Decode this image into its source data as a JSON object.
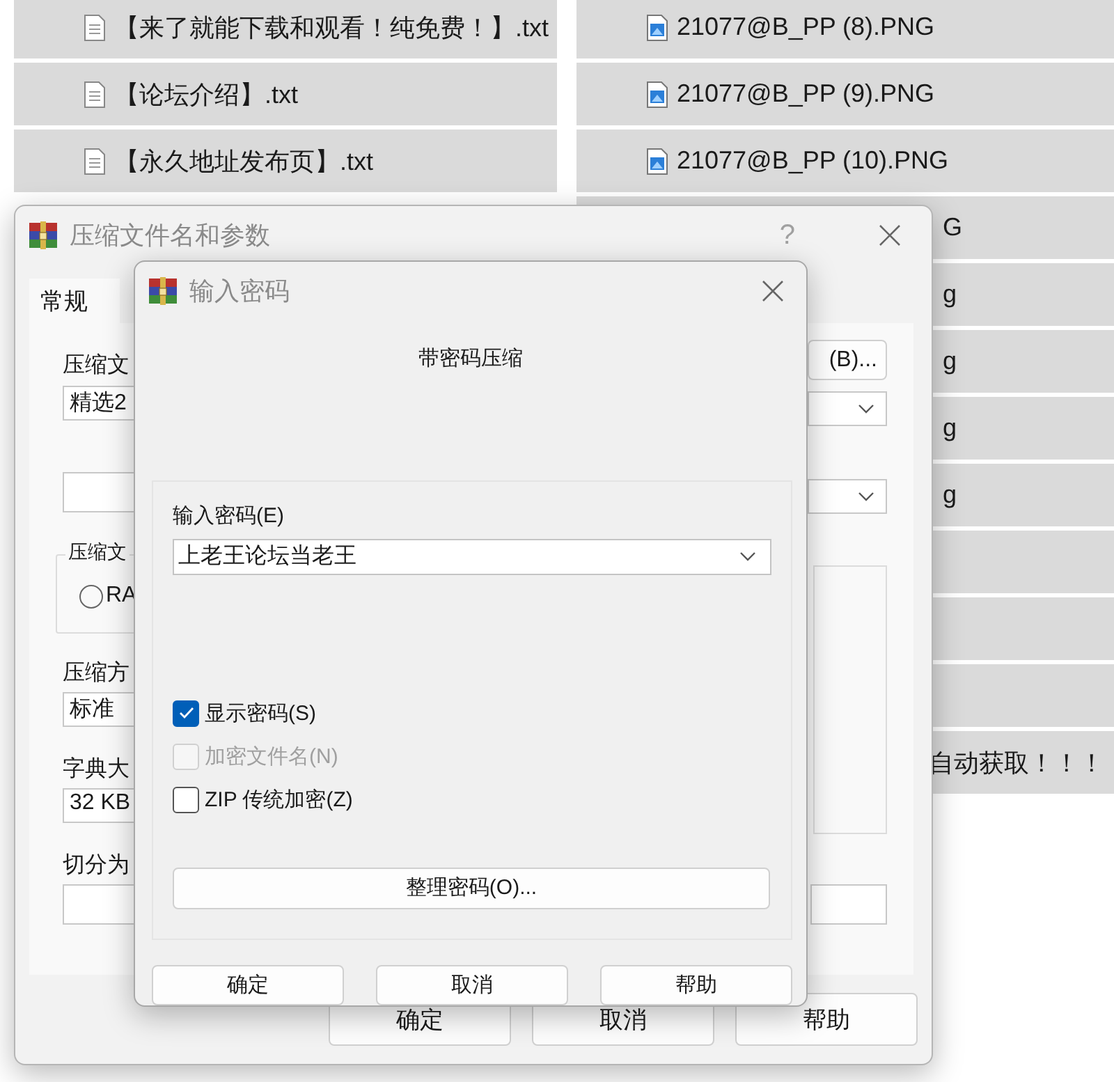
{
  "files_left": [
    {
      "name": "【来了就能下载和观看！纯免费！】.txt",
      "kind": "text"
    },
    {
      "name": "【论坛介绍】.txt",
      "kind": "text"
    },
    {
      "name": "【永久地址发布页】.txt",
      "kind": "text"
    }
  ],
  "files_right": [
    {
      "name": "21077@B_PP (8).PNG",
      "kind": "image"
    },
    {
      "name": "21077@B_PP (9).PNG",
      "kind": "image"
    },
    {
      "name": "21077@B_PP (10).PNG",
      "kind": "image"
    },
    {
      "name": "G",
      "kind": "covered"
    },
    {
      "name": "g",
      "kind": "covered"
    },
    {
      "name": "g",
      "kind": "covered"
    },
    {
      "name": "g",
      "kind": "covered"
    },
    {
      "name": "g",
      "kind": "covered"
    },
    {
      "kind": "blank"
    },
    {
      "kind": "blank"
    },
    {
      "kind": "blank"
    },
    {
      "name": "自动获取！！！",
      "kind": "covered"
    }
  ],
  "back_dialog": {
    "title": "压缩文件名和参数",
    "help": "?",
    "tab": "常规",
    "archive_label": "压缩文",
    "archive_name": "精选2",
    "browse_button": "(B)...",
    "format_group": "压缩文",
    "format_option": {
      "label": "RA",
      "selected": false
    },
    "method_label": "压缩方",
    "method": "标准",
    "dict_label": "字典大",
    "dict": "32 KB",
    "split_label": "切分为",
    "buttons": [
      "确定",
      "取消",
      "帮助"
    ]
  },
  "password_dialog": {
    "title": "输入密码",
    "heading": "带密码压缩",
    "password_label": "输入密码(E)",
    "password": "上老王论坛当老王",
    "options": [
      {
        "label": "显示密码(S)",
        "checked": true,
        "disabled": false
      },
      {
        "label": "加密文件名(N)",
        "checked": false,
        "disabled": true
      },
      {
        "label": "ZIP 传统加密(Z)",
        "checked": false,
        "disabled": false
      }
    ],
    "organize_button": "整理密码(O)...",
    "buttons": [
      "确定",
      "取消",
      "帮助"
    ]
  }
}
